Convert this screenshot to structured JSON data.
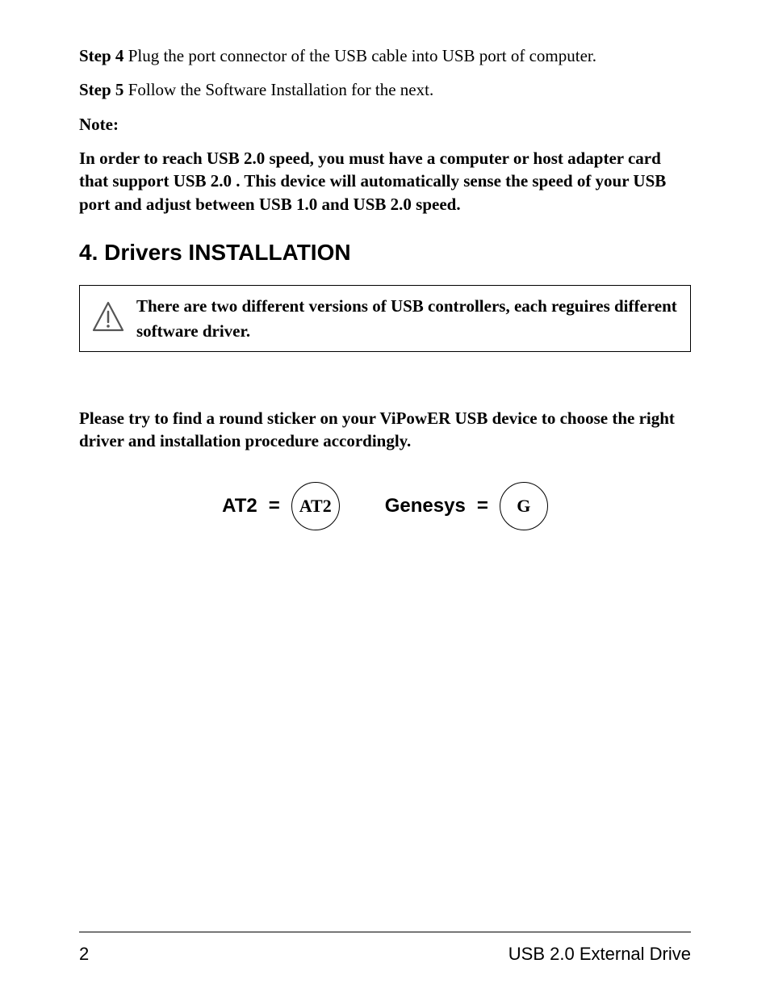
{
  "steps": {
    "step4_label": "Step 4",
    "step4_text": " Plug the port connector of the USB cable into USB port of computer.",
    "step5_label": "Step 5",
    "step5_text": " Follow the Software Installation for the next."
  },
  "note": {
    "label": "Note:",
    "body": "In order to reach USB 2.0 speed, you must have a computer or host adapter card that support USB 2.0 . This device will automatically sense the speed of your USB port and adjust between USB 1.0 and USB 2.0 speed."
  },
  "section_heading": "4. Drivers INSTALLATION",
  "callout_text": "There are two different versions of USB controllers, each reguires different software driver.",
  "sticker_instruction": "Please try to find a round sticker on your ViPowER USB device to choose the right driver and installation procedure accordingly.",
  "stickers": {
    "at2_label": "AT2",
    "at2_eq": "=",
    "at2_circle": "AT2",
    "genesys_label": "Genesys",
    "genesys_eq": "=",
    "genesys_circle": "G"
  },
  "footer": {
    "page_number": "2",
    "title": "USB 2.0 External Drive"
  }
}
